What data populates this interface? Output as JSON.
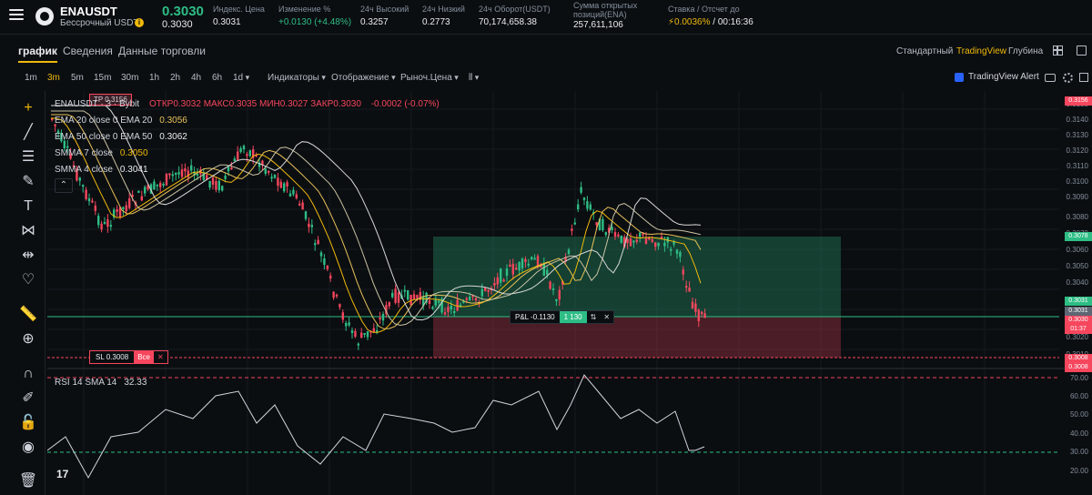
{
  "header": {
    "symbol": "ENAUSDT",
    "symbol_sub": "Бессрочный USDT",
    "last_price": "0.3030",
    "last_price_sub": "0.3030",
    "stats": [
      {
        "label": "Индекс. Цена",
        "value": "0.3031"
      },
      {
        "label": "Изменение %",
        "value": "+0.0130 (+4.48%)"
      },
      {
        "label": "24ч Высокий",
        "value": "0.3257"
      },
      {
        "label": "24ч Низкий",
        "value": "0.2773"
      },
      {
        "label": "24ч Оборот(USDT)",
        "value": "70,174,658.38"
      },
      {
        "label": "Сумма открытых",
        "label2": "позиций(ENA)",
        "value": "257,611,106"
      },
      {
        "label": "Ставка / Отсчет до",
        "value_rate": "0.0036%",
        "value_countdown": "/ 00:16:36"
      }
    ]
  },
  "tabs": {
    "chart": "график",
    "info": "Сведения",
    "trading_data": "Данные торговли",
    "view_standard": "Стандартный",
    "view_tradingview": "TradingView",
    "view_depth": "Глубина"
  },
  "toolbar": {
    "intervals": [
      "1m",
      "3m",
      "5m",
      "15m",
      "30m",
      "1h",
      "2h",
      "4h",
      "6h",
      "1d"
    ],
    "active_interval": "3m",
    "indicators": "Индикаторы",
    "display": "Отображение",
    "market_price": "Рыноч.Цена",
    "tv_alert": "TradingView Alert"
  },
  "legend": {
    "main": "ENAUSDT · 3 · Bybit",
    "ohlc": "ОТКР0.3032 МАКС0.3035 МИН0.3027 ЗАКР0.3030",
    "change": "-0.0002 (-0.07%)",
    "ema20_label": "EMA 20 close 0 EMA 20",
    "ema20_value": "0.3056",
    "ema50_label": "EMA 50 close 0 EMA 50",
    "ema50_value": "0.3062",
    "smma7_label": "SMMA 7 close",
    "smma7_value": "0.3050",
    "smma4_label": "SMMA 4 close",
    "smma4_value": "0.3041",
    "collapse": "⌃"
  },
  "orders": {
    "tp_label": "TP 0.3156",
    "sl_label": "SL 0.3008",
    "all_label": "Все",
    "pnl_label": "P&L -0.1130",
    "qty": "1 130"
  },
  "rsi": {
    "label": "RSI 14 SMA 14",
    "value": "32.33"
  },
  "price_axis": [
    "0.3150",
    "0.3140",
    "0.3130",
    "0.3120",
    "0.3110",
    "0.3100",
    "0.3090",
    "0.3080",
    "0.3070",
    "0.3060",
    "0.3050",
    "0.3040",
    "0.3020",
    "0.3010"
  ],
  "price_tags": {
    "tp": "0.3156",
    "entry_top": "0.3078",
    "green": "0.3031",
    "mark": "0.3031",
    "last": "0.3030",
    "countdown": "01:37",
    "sl": "0.3008",
    "sl2": "0.3008"
  },
  "rsi_axis": [
    "70.00",
    "60.00",
    "50.00",
    "40.00",
    "30.00",
    "20.00"
  ],
  "colors": {
    "up": "#2ebd85",
    "down": "#f6465d",
    "accent": "#f0b90b",
    "ema20": "#e8c15a",
    "ema50": "#d9d9d9",
    "rsi_line": "#d1d4dc"
  },
  "left_tools": [
    "crosshair-icon",
    "trendline-icon",
    "fib-icon",
    "brush-icon",
    "text-icon",
    "pattern-icon",
    "measure-icon",
    "heart-icon",
    "ruler-icon",
    "zoom-icon",
    "magnet-icon",
    "lock-draw-icon",
    "lock-icon",
    "eye-icon",
    "trash-icon"
  ]
}
